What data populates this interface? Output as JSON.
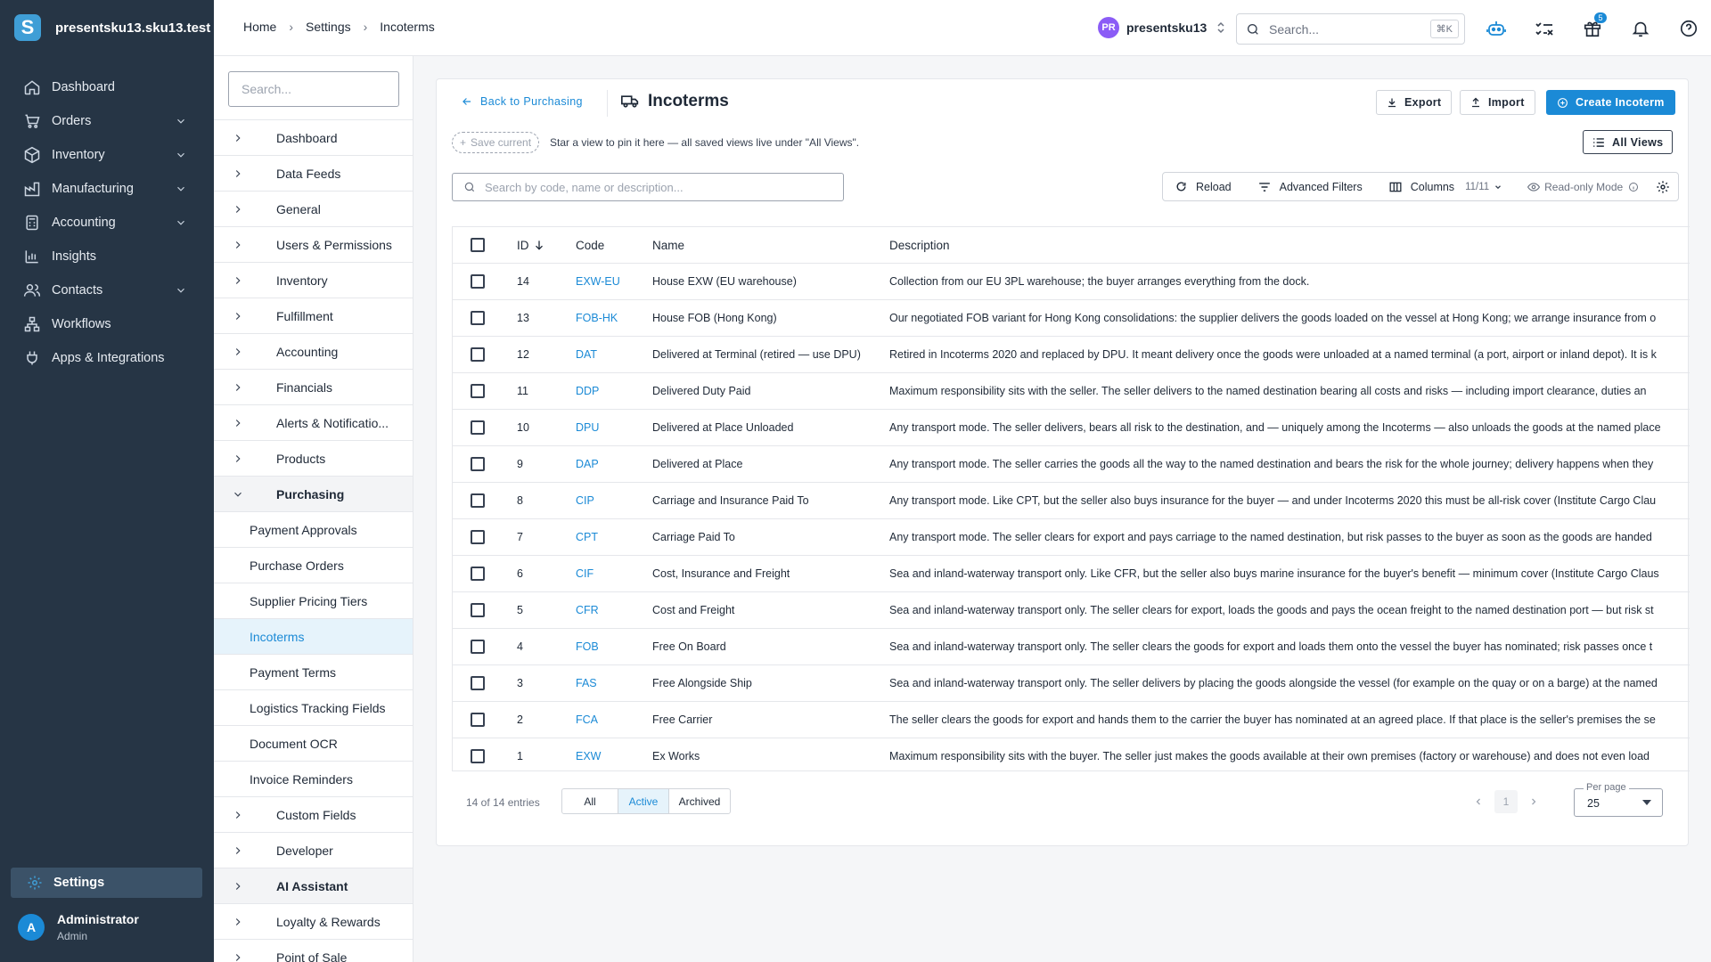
{
  "app": {
    "workspace": "presentsku13.sku13.test",
    "logo_letter": "S"
  },
  "sidebar": {
    "items": [
      {
        "label": "Dashboard",
        "icon": "home-icon",
        "expandable": false
      },
      {
        "label": "Orders",
        "icon": "cart-icon",
        "expandable": true
      },
      {
        "label": "Inventory",
        "icon": "box-icon",
        "expandable": true
      },
      {
        "label": "Manufacturing",
        "icon": "factory-icon",
        "expandable": true
      },
      {
        "label": "Accounting",
        "icon": "calculator-icon",
        "expandable": true
      },
      {
        "label": "Insights",
        "icon": "bar-chart-icon",
        "expandable": false
      },
      {
        "label": "Contacts",
        "icon": "users-icon",
        "expandable": true
      },
      {
        "label": "Workflows",
        "icon": "workflow-icon",
        "expandable": false
      },
      {
        "label": "Apps & Integrations",
        "icon": "plug-icon",
        "expandable": false
      }
    ],
    "settings_label": "Settings",
    "user": {
      "initial": "A",
      "name": "Administrator",
      "role": "Admin"
    }
  },
  "topbar": {
    "breadcrumb": [
      "Home",
      "Settings",
      "Incoterms"
    ],
    "account_initials": "PR",
    "account_name": "presentsku13",
    "search_placeholder": "Search...",
    "search_shortcut": "⌘K",
    "gift_badge": "5"
  },
  "settings_nav": {
    "search_placeholder": "Search...",
    "groups_before": [
      "Dashboard",
      "Data Feeds",
      "General",
      "Users & Permissions",
      "Inventory",
      "Fulfillment",
      "Accounting",
      "Financials",
      "Alerts & Notificatio...",
      "Products"
    ],
    "open_group": "Purchasing",
    "sub_items": [
      "Payment Approvals",
      "Purchase Orders",
      "Supplier Pricing Tiers",
      "Incoterms",
      "Payment Terms",
      "Logistics Tracking Fields",
      "Document OCR",
      "Invoice Reminders"
    ],
    "active_sub": "Incoterms",
    "groups_after": [
      "Custom Fields",
      "Developer",
      "AI Assistant",
      "Loyalty & Rewards",
      "Point of Sale"
    ]
  },
  "page": {
    "back_label": "Back to Purchasing",
    "title": "Incoterms",
    "export_label": "Export",
    "import_label": "Import",
    "create_label": "Create Incoterm",
    "save_current_label": "Save current",
    "pin_hint": "Star a view to pin it here — all saved views live under \"All Views\".",
    "all_views_label": "All Views",
    "search_placeholder": "Search by code, name or description...",
    "toolbar": {
      "reload": "Reload",
      "advanced_filters": "Advanced Filters",
      "columns": "Columns",
      "columns_count": "11/11",
      "read_only": "Read-only Mode"
    }
  },
  "table": {
    "headers": {
      "id": "ID",
      "code": "Code",
      "name": "Name",
      "description": "Description"
    },
    "rows": [
      {
        "id": "14",
        "code": "EXW-EU",
        "name": "House EXW (EU warehouse)",
        "description": "Collection from our EU 3PL warehouse; the buyer arranges everything from the dock."
      },
      {
        "id": "13",
        "code": "FOB-HK",
        "name": "House FOB (Hong Kong)",
        "description": "Our negotiated FOB variant for Hong Kong consolidations: the supplier delivers the goods loaded on the vessel at Hong Kong; we arrange insurance from o"
      },
      {
        "id": "12",
        "code": "DAT",
        "name": "Delivered at Terminal (retired — use DPU)",
        "description": "Retired in Incoterms 2020 and replaced by DPU. It meant delivery once the goods were unloaded at a named terminal (a port, airport or inland depot). It is k"
      },
      {
        "id": "11",
        "code": "DDP",
        "name": "Delivered Duty Paid",
        "description": "Maximum responsibility sits with the seller. The seller delivers to the named destination bearing all costs and risks — including import clearance, duties an"
      },
      {
        "id": "10",
        "code": "DPU",
        "name": "Delivered at Place Unloaded",
        "description": "Any transport mode. The seller delivers, bears all risk to the destination, and — uniquely among the Incoterms — also unloads the goods at the named place"
      },
      {
        "id": "9",
        "code": "DAP",
        "name": "Delivered at Place",
        "description": "Any transport mode. The seller carries the goods all the way to the named destination and bears the risk for the whole journey; delivery happens when they"
      },
      {
        "id": "8",
        "code": "CIP",
        "name": "Carriage and Insurance Paid To",
        "description": "Any transport mode. Like CPT, but the seller also buys insurance for the buyer — and under Incoterms 2020 this must be all-risk cover (Institute Cargo Clau"
      },
      {
        "id": "7",
        "code": "CPT",
        "name": "Carriage Paid To",
        "description": "Any transport mode. The seller clears for export and pays carriage to the named destination, but risk passes to the buyer as soon as the goods are handed"
      },
      {
        "id": "6",
        "code": "CIF",
        "name": "Cost, Insurance and Freight",
        "description": "Sea and inland-waterway transport only. Like CFR, but the seller also buys marine insurance for the buyer's benefit — minimum cover (Institute Cargo Claus"
      },
      {
        "id": "5",
        "code": "CFR",
        "name": "Cost and Freight",
        "description": "Sea and inland-waterway transport only. The seller clears for export, loads the goods and pays the ocean freight to the named destination port — but risk st"
      },
      {
        "id": "4",
        "code": "FOB",
        "name": "Free On Board",
        "description": "Sea and inland-waterway transport only. The seller clears the goods for export and loads them onto the vessel the buyer has nominated; risk passes once t"
      },
      {
        "id": "3",
        "code": "FAS",
        "name": "Free Alongside Ship",
        "description": "Sea and inland-waterway transport only. The seller delivers by placing the goods alongside the vessel (for example on the quay or on a barge) at the named"
      },
      {
        "id": "2",
        "code": "FCA",
        "name": "Free Carrier",
        "description": "The seller clears the goods for export and hands them to the carrier the buyer has nominated at an agreed place. If that place is the seller's premises the se"
      },
      {
        "id": "1",
        "code": "EXW",
        "name": "Ex Works",
        "description": "Maximum responsibility sits with the buyer. The seller just makes the goods available at their own premises (factory or warehouse) and does not even load"
      }
    ]
  },
  "footer": {
    "entries_text": "14 of 14 entries",
    "status_tabs": [
      "All",
      "Active",
      "Archived"
    ],
    "active_status": "Active",
    "current_page": "1",
    "per_page_label": "Per page",
    "per_page_value": "25"
  },
  "colors": {
    "accent": "#1b8ad6",
    "sidebar_bg": "#263545",
    "active_bg": "#e6f3fb"
  }
}
